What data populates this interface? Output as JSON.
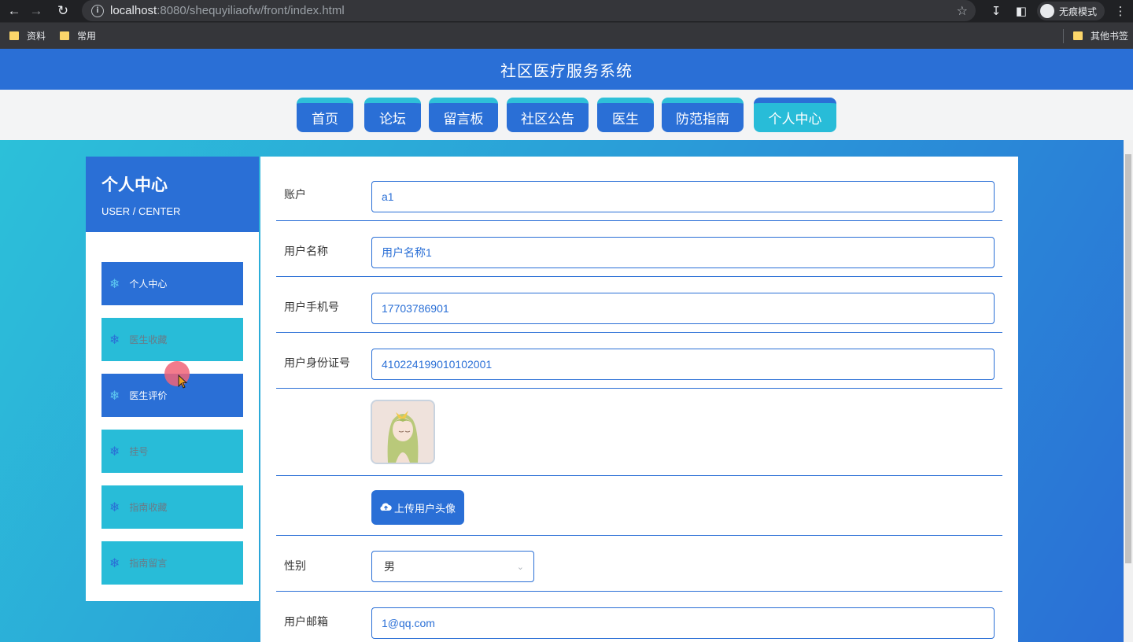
{
  "browser": {
    "url_host": "localhost",
    "url_path": ":8080/shequyiliaofw/front/index.html",
    "incognito_label": "无痕模式",
    "bookmarks": [
      "资料",
      "常用"
    ],
    "other_bookmarks": "其他书签"
  },
  "app": {
    "title": "社区医疗服务系统"
  },
  "topnav": {
    "items": [
      "首页",
      "论坛",
      "留言板",
      "社区公告",
      "医生",
      "防范指南",
      "个人中心"
    ],
    "active": "个人中心"
  },
  "sidebar": {
    "title": "个人中心",
    "subtitle": "USER / CENTER",
    "items": [
      "个人中心",
      "医生收藏",
      "医生评价",
      "挂号",
      "指南收藏",
      "指南留言"
    ],
    "item_icon": "snowflake-icon"
  },
  "form": {
    "account_label": "账户",
    "account_value": "a1",
    "username_label": "用户名称",
    "username_value": "用户名称1",
    "phone_label": "用户手机号",
    "phone_value": "17703786901",
    "idcard_label": "用户身份证号",
    "idcard_value": "410224199010102001",
    "upload_label": "上传用户头像",
    "gender_label": "性别",
    "gender_value": "男",
    "email_label": "用户邮箱",
    "email_value": "1@qq.com"
  },
  "colors": {
    "primary": "#2a6fd6",
    "accent": "#28bcd8"
  }
}
